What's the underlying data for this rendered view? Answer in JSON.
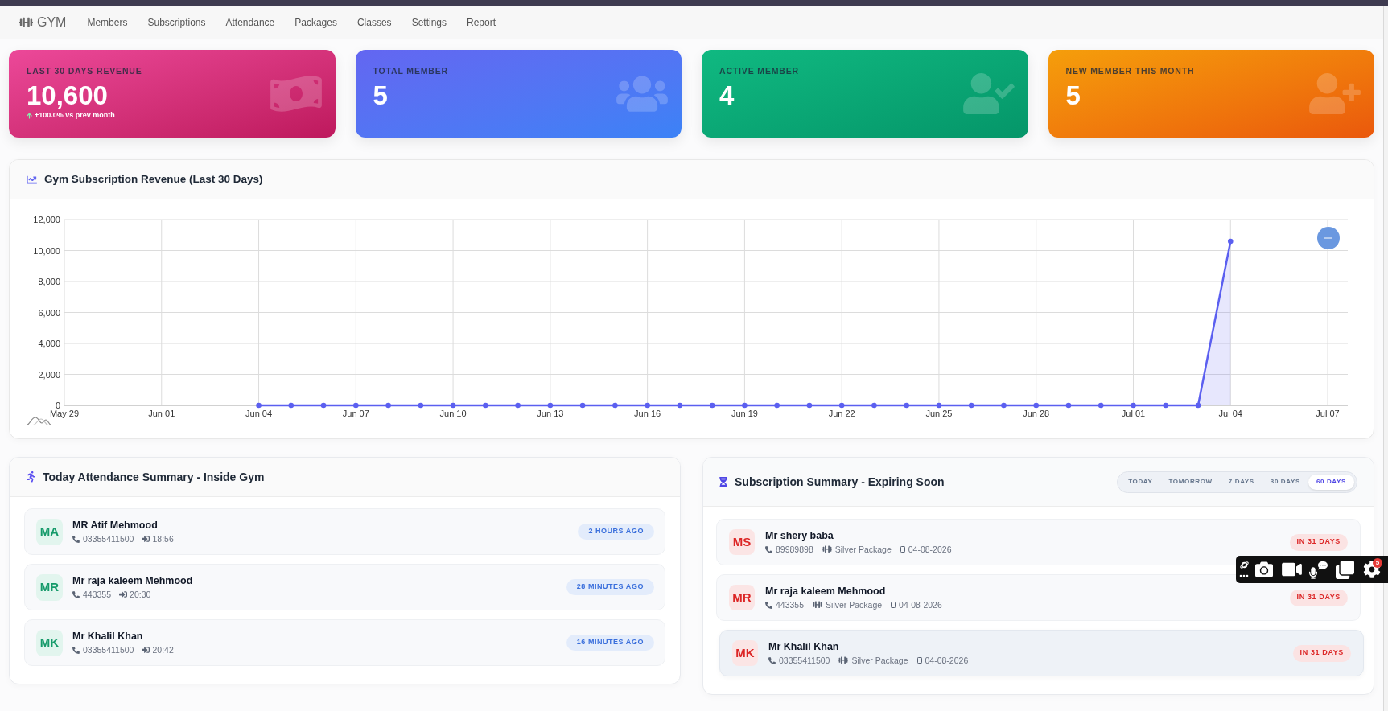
{
  "nav": {
    "brand": "GYM",
    "items": [
      "Members",
      "Subscriptions",
      "Attendance",
      "Packages",
      "Classes",
      "Settings",
      "Report"
    ]
  },
  "stat_cards": [
    {
      "kind": "revenue",
      "label": "LAST 30 DAYS REVENUE",
      "value": "10,600",
      "trend": "+100.0% vs prev month"
    },
    {
      "kind": "total",
      "label": "TOTAL MEMBER",
      "value": "5"
    },
    {
      "kind": "active",
      "label": "ACTIVE MEMBER",
      "value": "4"
    },
    {
      "kind": "new",
      "label": "NEW MEMBER THIS MONTH",
      "value": "5"
    }
  ],
  "revenue_chart": {
    "title": "Gym Subscription Revenue (Last 30 Days)",
    "chart_data": {
      "type": "area",
      "grid": true,
      "categories": [
        "May 29",
        null,
        null,
        "Jun 01",
        null,
        null,
        "Jun 04",
        null,
        null,
        "Jun 07",
        null,
        null,
        "Jun 10",
        null,
        null,
        "Jun 13",
        null,
        null,
        "Jun 16",
        null,
        null,
        "Jun 19",
        null,
        null,
        "Jun 22",
        null,
        null,
        "Jun 25",
        null,
        null,
        "Jun 28",
        null,
        null,
        "Jul 01",
        null,
        null,
        "Jul 04",
        null,
        null,
        "Jul 07"
      ],
      "series": [
        {
          "color": "#5b5ff0",
          "values": [
            null,
            null,
            null,
            null,
            null,
            null,
            0,
            0,
            0,
            0,
            0,
            0,
            0,
            0,
            0,
            0,
            0,
            0,
            0,
            0,
            0,
            0,
            0,
            0,
            0,
            0,
            0,
            0,
            0,
            0,
            0,
            0,
            0,
            0,
            0,
            0,
            10600,
            null,
            null,
            null
          ]
        }
      ],
      "ylim": [
        0,
        12000
      ],
      "yticks": [
        {
          "value": 0,
          "label": "0"
        },
        {
          "value": 2000,
          "label": "2,000"
        },
        {
          "value": 4000,
          "label": "4,000"
        },
        {
          "value": 6000,
          "label": "6,000"
        },
        {
          "value": 8000,
          "label": "8,000"
        },
        {
          "value": 10000,
          "label": "10,000"
        },
        {
          "value": 12000,
          "label": "12,000"
        }
      ]
    }
  },
  "attendance": {
    "title": "Today Attendance Summary - Inside Gym",
    "rows": [
      {
        "initials": "MA",
        "name": "MR Atif Mehmood",
        "phone": "03355411500",
        "check_in": "18:56",
        "ago": "2 HOURS AGO"
      },
      {
        "initials": "MR",
        "name": "Mr raja kaleem Mehmood",
        "phone": "443355",
        "check_in": "20:30",
        "ago": "28 MINUTES AGO"
      },
      {
        "initials": "MK",
        "name": "Mr Khalil Khan",
        "phone": "03355411500",
        "check_in": "20:42",
        "ago": "16 MINUTES AGO"
      }
    ]
  },
  "subscriptions": {
    "title": "Subscription Summary - Expiring Soon",
    "filters": [
      {
        "label": "TODAY",
        "selected": false
      },
      {
        "label": "TOMORROW",
        "selected": false
      },
      {
        "label": "7 DAYS",
        "selected": false
      },
      {
        "label": "30 DAYS",
        "selected": false
      },
      {
        "label": "60 DAYS",
        "selected": true
      }
    ],
    "rows": [
      {
        "initials": "MS",
        "name": "Mr shery baba",
        "phone": "89989898",
        "package": "Silver Package",
        "date": "04-08-2026",
        "due": "IN 31 DAYS",
        "hovered": false
      },
      {
        "initials": "MR",
        "name": "Mr raja kaleem Mehmood",
        "phone": "443355",
        "package": "Silver Package",
        "date": "04-08-2026",
        "due": "IN 31 DAYS",
        "hovered": false
      },
      {
        "initials": "MK",
        "name": "Mr Khalil Khan",
        "phone": "03355411500",
        "package": "Silver Package",
        "date": "04-08-2026",
        "due": "IN 31 DAYS",
        "hovered": true
      }
    ]
  },
  "recorder_toolbar": {
    "badge": "5"
  }
}
